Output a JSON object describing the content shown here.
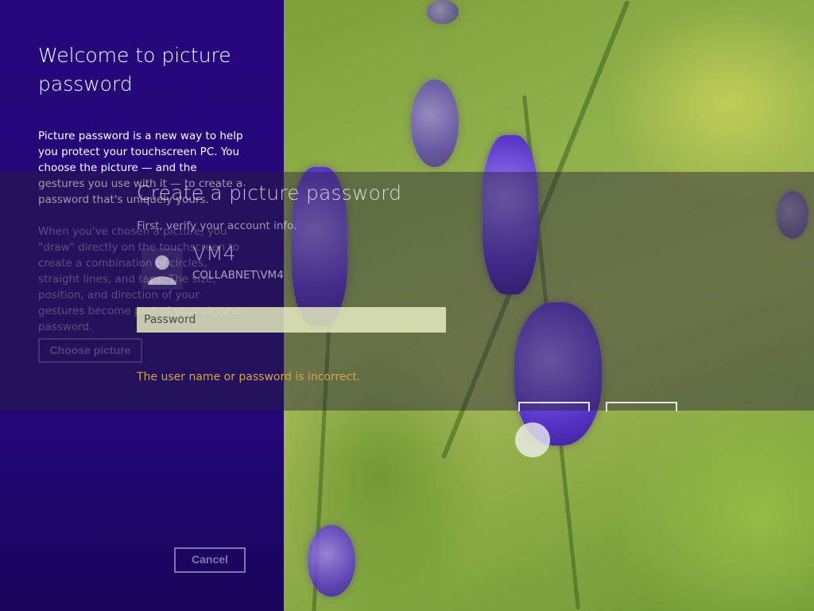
{
  "left_panel": {
    "title": "Welcome to picture password",
    "paragraph1": "Picture password is a new way to help you protect your touchscreen PC. You choose the picture — and the gestures you use with it — to create a password that's uniquely yours.",
    "paragraph2": "When you've chosen a picture, you \"draw\" directly on the touchscreen to create a combination of circles, straight lines, and taps. The size, position, and direction of your gestures become part of your picture password.",
    "choose_picture_label": "Choose picture",
    "cancel_label": "Cancel"
  },
  "dialog": {
    "title": "Create a picture password",
    "subtitle": "First, verify your account info.",
    "account_name": "VM4",
    "account_domain": "COLLABNET\\VM4",
    "password_placeholder": "Password",
    "error": "The user name or password is incorrect."
  },
  "colors": {
    "panel_purple": "#24077a",
    "error_text": "#d6a34a"
  },
  "icons": {
    "avatar": "user-icon"
  }
}
